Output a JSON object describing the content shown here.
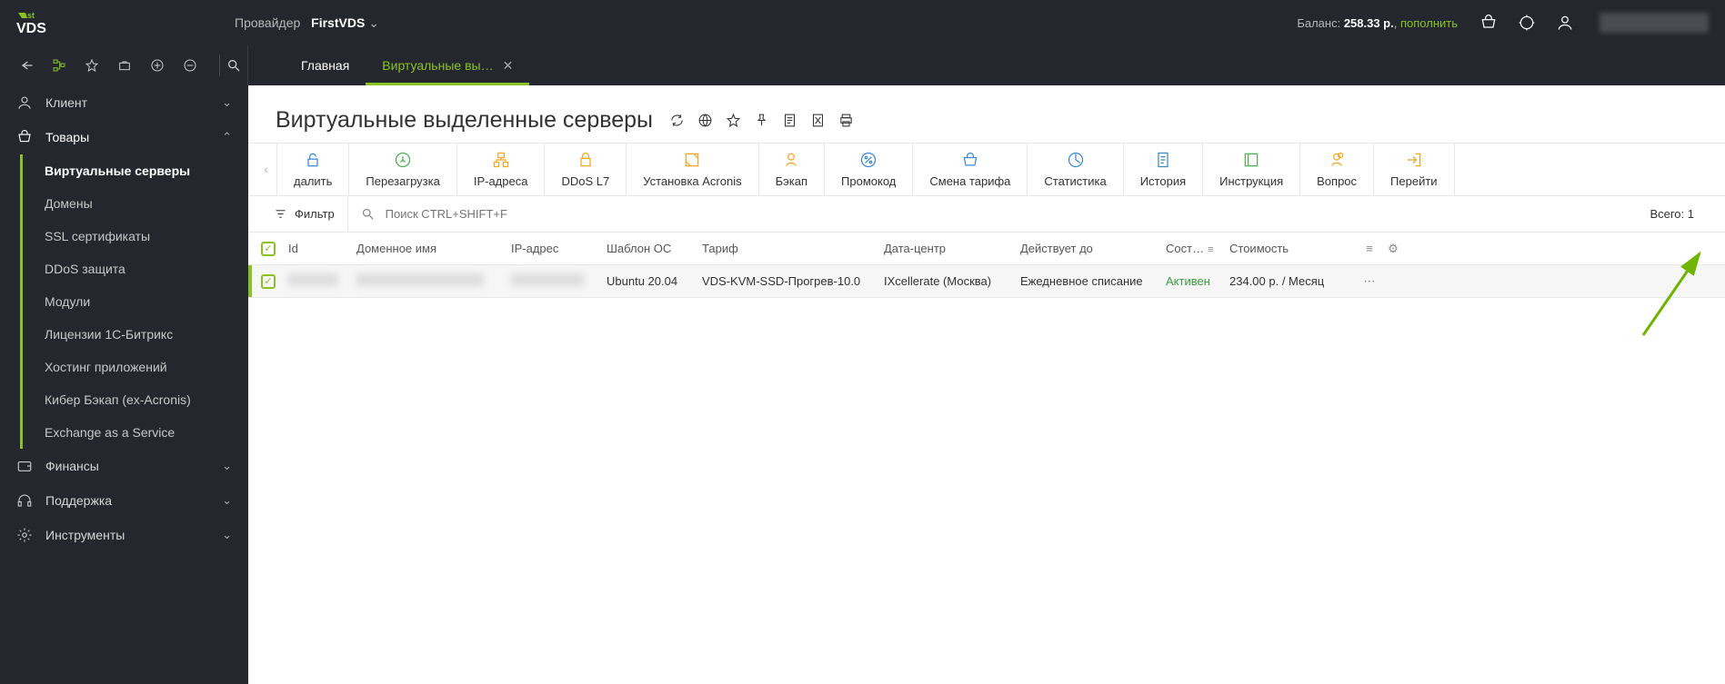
{
  "header": {
    "provider_label": "Провайдер",
    "provider_name": "FirstVDS",
    "balance_label": "Баланс:",
    "balance_value": "258.33 р.",
    "topup": "пополнить"
  },
  "tabs": [
    {
      "label": "Главная",
      "active": false,
      "closable": false
    },
    {
      "label": "Виртуальные вы…",
      "active": true,
      "closable": true
    }
  ],
  "sidebar": {
    "groups": [
      {
        "icon": "user",
        "label": "Клиент",
        "expanded": false
      },
      {
        "icon": "basket",
        "label": "Товары",
        "expanded": true,
        "items": [
          {
            "label": "Виртуальные серверы",
            "active": true
          },
          {
            "label": "Домены"
          },
          {
            "label": "SSL сертификаты"
          },
          {
            "label": "DDoS защита"
          },
          {
            "label": "Модули"
          },
          {
            "label": "Лицензии 1С-Битрикс"
          },
          {
            "label": "Хостинг приложений"
          },
          {
            "label": "Кибер Бэкап (ex-Acronis)"
          },
          {
            "label": "Exchange as a Service"
          }
        ]
      },
      {
        "icon": "wallet",
        "label": "Финансы",
        "expanded": false
      },
      {
        "icon": "headset",
        "label": "Поддержка",
        "expanded": false
      },
      {
        "icon": "gear",
        "label": "Инструменты",
        "expanded": false
      }
    ]
  },
  "page": {
    "title": "Виртуальные выделенные серверы"
  },
  "toolbar": [
    {
      "icon": "lock",
      "label": "далить",
      "color": "blue"
    },
    {
      "icon": "power",
      "label": "Перезагрузка",
      "color": "green"
    },
    {
      "icon": "ip",
      "label": "IP-адреса",
      "color": "orange"
    },
    {
      "icon": "shield",
      "label": "DDoS L7",
      "color": "orange"
    },
    {
      "icon": "install",
      "label": "Установка Acronis",
      "color": "orange"
    },
    {
      "icon": "backup",
      "label": "Бэкап",
      "color": "orange"
    },
    {
      "icon": "promo",
      "label": "Промокод",
      "color": "blue"
    },
    {
      "icon": "tariff",
      "label": "Смена тарифа",
      "color": "blue"
    },
    {
      "icon": "stats",
      "label": "Статистика",
      "color": "blue"
    },
    {
      "icon": "history",
      "label": "История",
      "color": "blue"
    },
    {
      "icon": "manual",
      "label": "Инструкция",
      "color": "green"
    },
    {
      "icon": "question",
      "label": "Вопрос",
      "color": "orange"
    },
    {
      "icon": "goto",
      "label": "Перейти",
      "color": "orange"
    }
  ],
  "filter": {
    "label": "Фильтр",
    "search_placeholder": "Поиск CTRL+SHIFT+F",
    "total_label": "Всего:",
    "total_value": "1"
  },
  "table": {
    "columns": {
      "id": "Id",
      "domain": "Доменное имя",
      "ip": "IP-адрес",
      "template": "Шаблон ОС",
      "tariff": "Тариф",
      "dc": "Дата-центр",
      "valid": "Действует до",
      "status": "Сост…",
      "price": "Стоимость"
    },
    "row": {
      "template": "Ubuntu 20.04",
      "tariff": "VDS-KVM-SSD-Прогрев-10.0",
      "dc": "IXcellerate (Москва)",
      "valid": "Ежедневное списание",
      "status": "Активен",
      "price": "234.00 р. / Месяц"
    }
  }
}
